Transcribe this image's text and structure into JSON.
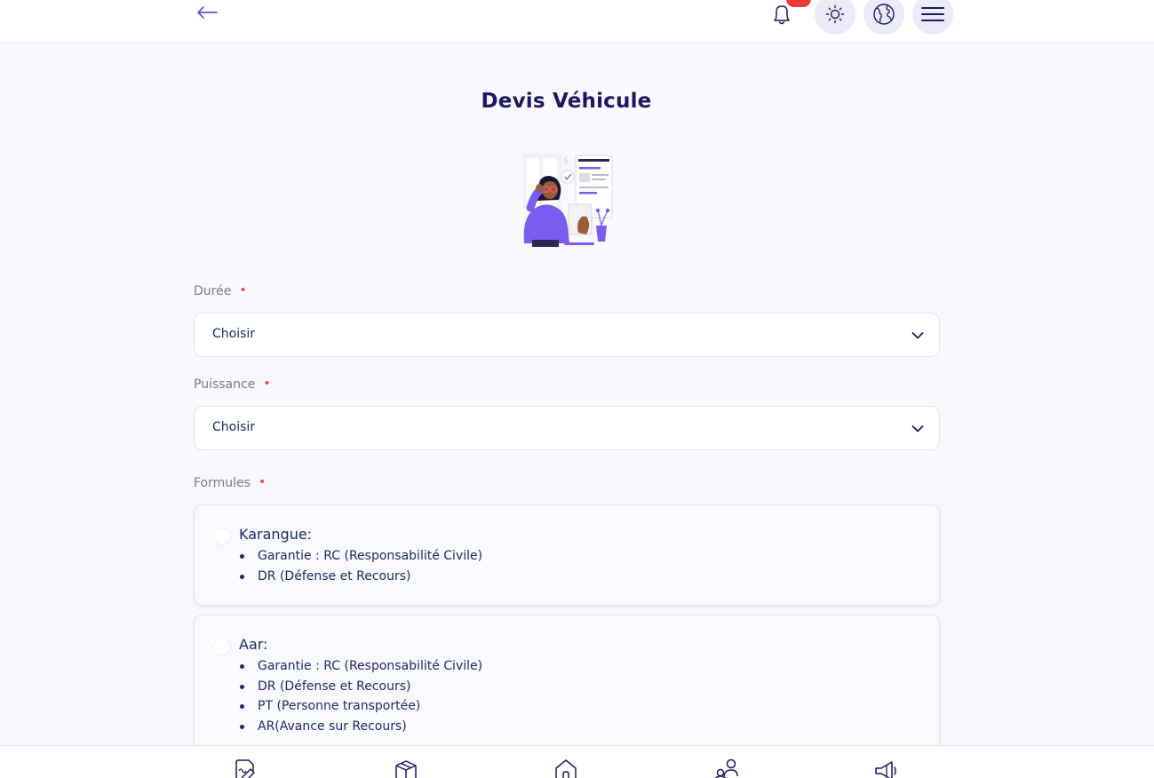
{
  "header": {
    "back_icon": "arrow-left-icon",
    "notifications": {
      "icon": "bell-icon",
      "badge": ""
    },
    "theme_icon": "sun-icon",
    "language_icon": "globe-icon",
    "menu_icon": "hamburger-menu-icon"
  },
  "page": {
    "title": "Devis Véhicule",
    "illustration": "woman-with-glasses-reviewing-quote-illustration"
  },
  "form": {
    "duree": {
      "label": "Durée",
      "required_mark": "•",
      "value": "Choisir"
    },
    "puissance": {
      "label": "Puissance",
      "required_mark": "•",
      "value": "Choisir"
    },
    "formules": {
      "label": "Formules",
      "required_mark": "•",
      "options": [
        {
          "title": "Karangue:",
          "items": [
            "Garantie : RC (Responsabilité Civile)",
            "DR (Défense et Recours)"
          ]
        },
        {
          "title": "Aar:",
          "items": [
            "Garantie : RC (Responsabilité Civile)",
            "DR (Défense et Recours)",
            "PT (Personne transportée)",
            "AR(Avance sur Recours)"
          ]
        }
      ]
    }
  },
  "bottom_nav": {
    "items": [
      "document-edit-icon",
      "box-icon",
      "home-icon",
      "users-icon",
      "megaphone-icon"
    ]
  },
  "colors": {
    "accent": "#6c4ce0",
    "badge": "#f23b3b",
    "title": "#1e1760",
    "text": "#1e2a63",
    "label": "#7a7795",
    "required": "#f24a4a",
    "background": "#f8f8fd"
  }
}
